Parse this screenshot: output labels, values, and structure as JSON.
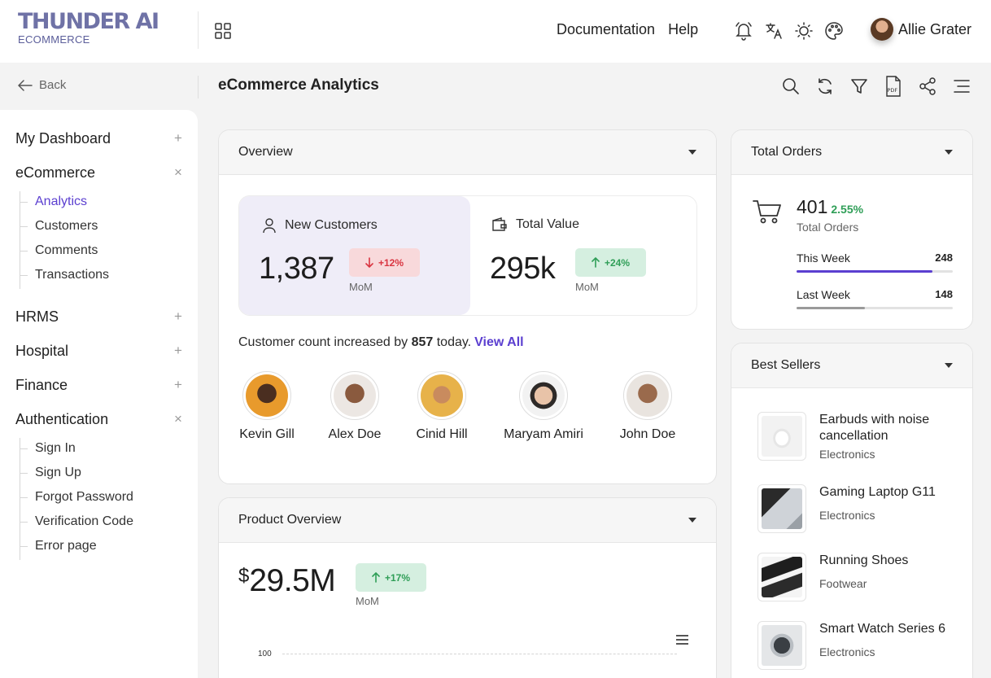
{
  "brand": {
    "name": "THUNDER AI",
    "subtitle": "ECOMMERCE"
  },
  "topnav": {
    "links": [
      "Documentation",
      "Help"
    ],
    "icons": [
      "bell-icon",
      "translate-icon",
      "sun-icon",
      "palette-icon"
    ],
    "user": {
      "name": "Allie Grater"
    }
  },
  "subheader": {
    "back_label": "Back",
    "title": "eCommerce Analytics",
    "tools": [
      "search-icon",
      "refresh-icon",
      "filter-icon",
      "pdf-icon",
      "share-icon",
      "menu-icon"
    ]
  },
  "sidebar": {
    "groups": [
      {
        "label": "My Dashboard",
        "toggle": "+",
        "items": []
      },
      {
        "label": "eCommerce",
        "toggle": "×",
        "items": [
          "Analytics",
          "Customers",
          "Comments",
          "Transactions"
        ],
        "active": "Analytics"
      },
      {
        "label": "HRMS",
        "toggle": "+",
        "items": []
      },
      {
        "label": "Hospital",
        "toggle": "+",
        "items": []
      },
      {
        "label": "Finance",
        "toggle": "+",
        "items": []
      },
      {
        "label": "Authentication",
        "toggle": "×",
        "items": [
          "Sign In",
          "Sign Up",
          "Forgot Password",
          "Verification Code",
          "Error page"
        ]
      }
    ]
  },
  "overview": {
    "title": "Overview",
    "new_customers": {
      "label": "New Customers",
      "value": "1,387",
      "change": "+12%",
      "period": "MoM"
    },
    "total_value": {
      "label": "Total Value",
      "value": "295k",
      "change": "+24%",
      "period": "MoM"
    },
    "count_text_prefix": "Customer count increased by",
    "count_value": "857",
    "count_text_suffix": "today.",
    "view_all": "View All",
    "people": [
      "Kevin Gill",
      "Alex Doe",
      "Cinid Hill",
      "Maryam Amiri",
      "John Doe"
    ]
  },
  "product_overview": {
    "title": "Product Overview",
    "currency": "$",
    "amount": "29.5M",
    "change": "+17%",
    "period": "MoM",
    "chart_tick": "100"
  },
  "total_orders": {
    "title": "Total Orders",
    "value": "401",
    "change": "2.55%",
    "label": "Total Orders",
    "rows": [
      {
        "label": "This Week",
        "value": "248",
        "fill": 0.87,
        "color": "#5b3fd0"
      },
      {
        "label": "Last Week",
        "value": "148",
        "fill": 0.44,
        "color": "#9a9a9a"
      }
    ]
  },
  "best_sellers": {
    "title": "Best Sellers",
    "items": [
      {
        "name": "Earbuds with noise cancellation",
        "category": "Electronics"
      },
      {
        "name": "Gaming Laptop G11",
        "category": "Electronics"
      },
      {
        "name": "Running Shoes",
        "category": "Footwear"
      },
      {
        "name": "Smart Watch Series 6",
        "category": "Electronics"
      }
    ]
  },
  "colors": {
    "accent": "#5b3fd0",
    "down": "#d93440",
    "up": "#2f9e57",
    "brand": "#6f72a6"
  }
}
